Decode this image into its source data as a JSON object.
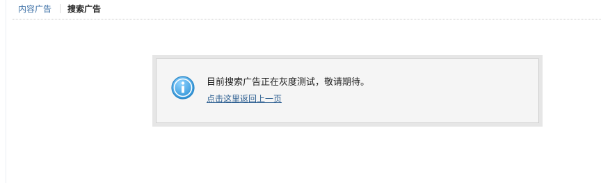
{
  "tabs": {
    "content_ads": "内容广告",
    "search_ads": "搜索广告"
  },
  "notice": {
    "icon": "info-icon",
    "message": "目前搜索广告正在灰度测试，敬请期待。",
    "back_link": "点击这里返回上一页"
  },
  "colors": {
    "link": "#2d5f91",
    "icon": "#3aa4e3",
    "notice_bg": "#f5f5f5",
    "notice_frame": "#e6e6e6"
  }
}
